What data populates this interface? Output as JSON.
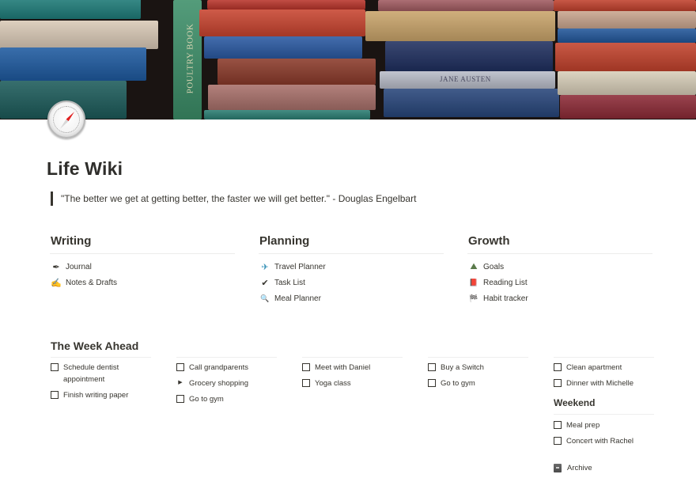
{
  "page": {
    "title": "Life Wiki",
    "icon": "compass-icon",
    "cover": "vintage-books-cover",
    "quote": "\"The better we get at getting better, the faster we will get better.\" - Douglas Engelbart"
  },
  "sections": [
    {
      "heading": "Writing",
      "items": [
        {
          "icon": "fountain-pen-icon",
          "glyph": "✒",
          "label": "Journal"
        },
        {
          "icon": "writing-hand-icon",
          "glyph": "✍",
          "label": "Notes & Drafts"
        }
      ]
    },
    {
      "heading": "Planning",
      "items": [
        {
          "icon": "airplane-icon",
          "glyph": "✈",
          "label": "Travel Planner"
        },
        {
          "icon": "check-mark-icon",
          "glyph": "✔",
          "label": "Task List"
        },
        {
          "icon": "magnifier-icon",
          "glyph": "🔍",
          "label": "Meal Planner"
        }
      ]
    },
    {
      "heading": "Growth",
      "items": [
        {
          "icon": "mountain-icon",
          "glyph": "⛰",
          "label": "Goals"
        },
        {
          "icon": "red-book-icon",
          "glyph": "📕",
          "label": "Reading List"
        },
        {
          "icon": "checkered-flag-icon",
          "glyph": "🏁",
          "label": "Habit tracker"
        }
      ]
    }
  ],
  "week": {
    "heading": "The Week Ahead",
    "columns": [
      [
        {
          "type": "todo",
          "label": "Schedule dentist appointment",
          "checked": false
        },
        {
          "type": "todo",
          "label": "Finish writing paper",
          "checked": false
        }
      ],
      [
        {
          "type": "todo",
          "label": "Call grandparents",
          "checked": false
        },
        {
          "type": "toggle",
          "label": "Grocery shopping"
        },
        {
          "type": "todo",
          "label": "Go to gym",
          "checked": false
        }
      ],
      [
        {
          "type": "todo",
          "label": "Meet with Daniel",
          "checked": false
        },
        {
          "type": "todo",
          "label": "Yoga class",
          "checked": false
        }
      ],
      [
        {
          "type": "todo",
          "label": "Buy a Switch",
          "checked": false
        },
        {
          "type": "todo",
          "label": "Go to gym",
          "checked": false
        }
      ],
      [
        {
          "type": "todo",
          "label": "Clean apartment",
          "checked": false
        },
        {
          "type": "todo",
          "label": "Dinner with Michelle",
          "checked": false
        }
      ]
    ],
    "weekend": {
      "heading": "Weekend",
      "items": [
        {
          "type": "todo",
          "label": "Meal prep",
          "checked": false
        },
        {
          "type": "todo",
          "label": "Concert with Rachel",
          "checked": false
        }
      ]
    },
    "archive": {
      "icon": "file-cabinet-icon",
      "label": "Archive"
    }
  }
}
